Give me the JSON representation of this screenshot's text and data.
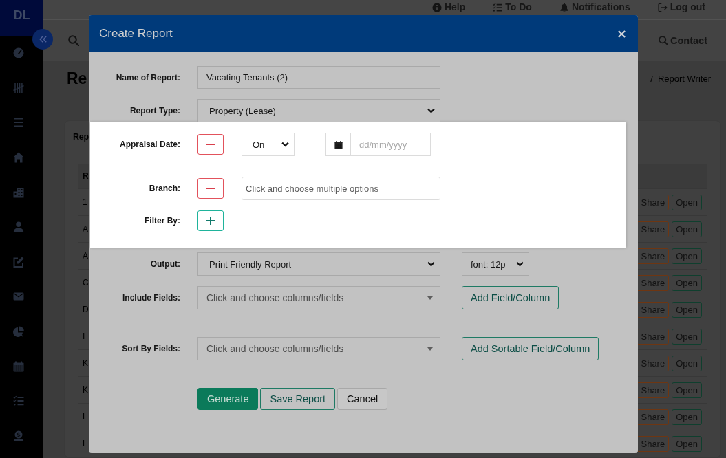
{
  "sidebar": {
    "logo": "DL"
  },
  "top_bar": {
    "links": [
      {
        "label": "Help"
      },
      {
        "label": "To Do"
      },
      {
        "label": "Notifications"
      },
      {
        "label": "Log out"
      }
    ]
  },
  "toolbar": {
    "contact": "Contact"
  },
  "page": {
    "title": "Re",
    "breadcrumb": {
      "separator": "/",
      "current": "Report Writer"
    }
  },
  "card": {
    "title": "Rep",
    "table": {
      "column_1": "R",
      "rows": [
        {
          "column_1": "1",
          "share": "Share",
          "open": "Open"
        },
        {
          "column_1": "A",
          "share": "Share",
          "open": "Open"
        },
        {
          "column_1": "A",
          "share": "Share",
          "open": "Open"
        },
        {
          "column_1": "C",
          "share": "Share",
          "open": "Open"
        },
        {
          "column_1": "D",
          "share": "Share",
          "open": "Open"
        },
        {
          "column_1": "I",
          "share": "Share",
          "open": "Open"
        },
        {
          "column_1": "K",
          "share": "Share",
          "open": "Open"
        },
        {
          "column_1": "K",
          "share": "Share",
          "open": "Open"
        },
        {
          "column_1": "L",
          "share": "Share",
          "open": "Open"
        },
        {
          "column_1": "L",
          "share": "Share",
          "open": "Open"
        }
      ]
    }
  },
  "dialog": {
    "title": "Create Report",
    "close": "×",
    "sections": [
      {
        "highlighted": false,
        "rows": [
          {
            "kind": "text",
            "label": "Name of Report:",
            "value": "Vacating Tenants (2)"
          },
          {
            "kind": "select",
            "label": "Report Type:",
            "value": "Property (Lease)"
          }
        ]
      },
      {
        "highlighted": true,
        "rows": [
          {
            "kind": "date_filter",
            "label": "Appraisal Date:",
            "operator": "On",
            "placeholder": "dd/mm/yyyy"
          },
          {
            "kind": "multi_filter",
            "label": "Branch:",
            "placeholder": "Click and choose multiple options"
          },
          {
            "kind": "add_filter",
            "label": "Filter By:"
          }
        ]
      },
      {
        "highlighted": false,
        "rows": [
          {
            "kind": "output",
            "label": "Output:",
            "value": "Print Friendly Report",
            "font": "font: 12p"
          },
          {
            "kind": "picker",
            "label": "Include Fields:",
            "placeholder": "Click and choose columns/fields",
            "button": "Add Field/Column"
          },
          {
            "kind": "picker",
            "label": "Sort By Fields:",
            "placeholder": "Click and choose columns/fields",
            "button": "Add Sortable Field/Column"
          }
        ]
      }
    ],
    "buttons": [
      {
        "kind": "primary",
        "label": "Generate"
      },
      {
        "kind": "outline",
        "label": "Save Report"
      },
      {
        "kind": "default",
        "label": "Cancel"
      }
    ]
  }
}
